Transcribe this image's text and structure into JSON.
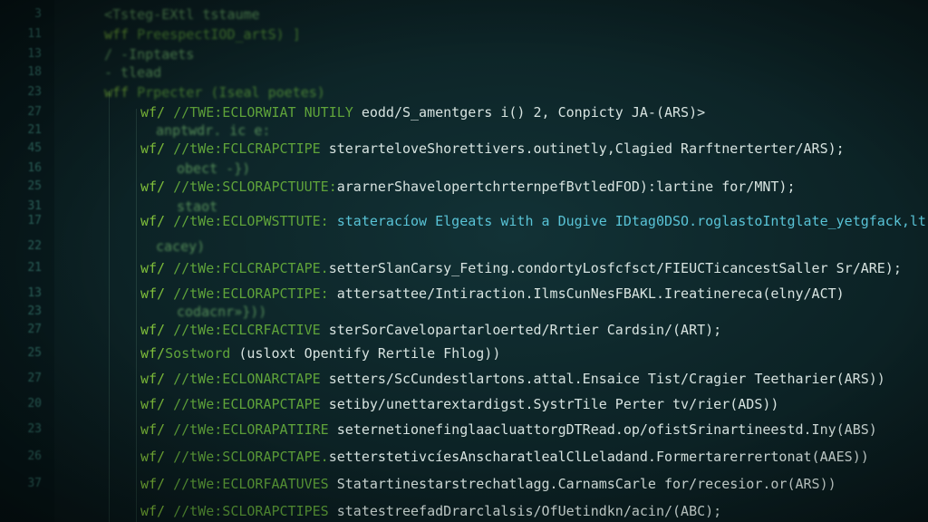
{
  "editor": {
    "line_numbers": [
      "3",
      "11",
      "13",
      "18",
      "23",
      "27",
      "21",
      "45",
      "16",
      "25",
      "31",
      "17",
      "22",
      "21",
      "13",
      "23",
      "27",
      "25",
      "27",
      "20",
      "23",
      "26",
      "37"
    ],
    "lines": [
      {
        "keyword": "",
        "comment": "<Tsteg-EXtl tstaume",
        "body": ""
      },
      {
        "keyword": "wff",
        "comment": " PreespectIOD_artS) ]",
        "body": ""
      },
      {
        "keyword": "",
        "comment": "/ -Inptaets",
        "body": ""
      },
      {
        "keyword": "",
        "comment": "- tlead",
        "body": ""
      },
      {
        "keyword": "wff",
        "comment": " Prpecter (Iseal poetes)",
        "body": ""
      },
      {
        "keyword": "wf/",
        "comment": " //TWE:ECLORWIAT NUTILY",
        "body": " eodd/S_amentgers i() 2, Conpicty JA-(ARS)>"
      },
      {
        "keyword": "",
        "comment": "anptwdr. ic e:",
        "body": ""
      },
      {
        "keyword": "wf/",
        "comment": " //tWe:FCLCRAPCTIPE",
        "body": " sterarteloveShorettivers.outinetly,Clagied Rarftnerterter/ARS);"
      },
      {
        "keyword": "",
        "comment": "obect -})",
        "body": ""
      },
      {
        "keyword": "wf/",
        "comment": " //tWe:SCLORAPCTUUTE:",
        "body": "ararnerShavelopertchrternpefBvtledFOD):lartine for/MNT);"
      },
      {
        "keyword": "",
        "comment": "staot",
        "body": ""
      },
      {
        "keyword": "wf/",
        "comment": " //tWe:ECLOPWSTTUTE:",
        "body": " stateracíow Elgeats with a Dugive IDtag0DSO.roglastoIntglate_yetgfack,lt)"
      },
      {
        "keyword": "",
        "comment": "cacey)",
        "body": ""
      },
      {
        "keyword": "wf/",
        "comment": " //tWe:FCLCRAPCTAPE.",
        "body": "setterSlanCarsy_Feting.condortyLosfcfsct/FIEUCTicancestSaller Sr/ARE);"
      },
      {
        "keyword": "wf/",
        "comment": " //tWe:ECLORAPCTIPE:",
        "body": " attersattee/Intiraction.IlmsCunNesFBAKL.Ireatinereca(elny/ACT)"
      },
      {
        "keyword": "",
        "comment": "codacnr»}))",
        "body": ""
      },
      {
        "keyword": "wf/",
        "comment": " //tWe:ECLCRFACTIVE",
        "body": " sterSorCavelopartarloerted/Rrtier Cardsin/(ART);"
      },
      {
        "keyword": "wf/",
        "comment": "Sostword",
        "body": " (usloxt Opentify Rertile Fhlog))"
      },
      {
        "keyword": "wf/",
        "comment": " //tWe:ECLONARCTAPE",
        "body": " setters/ScCundestlartons.attal.Ensaice Tist/Cragier Teetharier(ARS))"
      },
      {
        "keyword": "wf/",
        "comment": " //tWe:ECLORAPCTAPE",
        "body": " setiby/unettarextardigst.SystrTile Perter tv/rier(ADS))"
      },
      {
        "keyword": "wf/",
        "comment": " //tWe:ECLORAPATIIRE",
        "body": " seternetionefinglaacluattorgDTRead.op/ofistSrinartineestd.Iny(ABS)"
      },
      {
        "keyword": "wf/",
        "comment": " //tWe:SCLORAPCTAPE.",
        "body": "setterstetivcíesAnscharatlealClLeladand.Formertarerrertonat(AAES))"
      },
      {
        "keyword": "wf/",
        "comment": " //tWe:ECLORFAATUVES",
        "body": " Statartinestarstrechatlagg.CarnamsCarle for/recesior.or(ARS))"
      },
      {
        "keyword": "wf/",
        "comment": " //tWe:SCLORAPCTIPES",
        "body": " statestreefadDrarclalsis/OfUetindkn/acin/(ABC);"
      }
    ]
  }
}
